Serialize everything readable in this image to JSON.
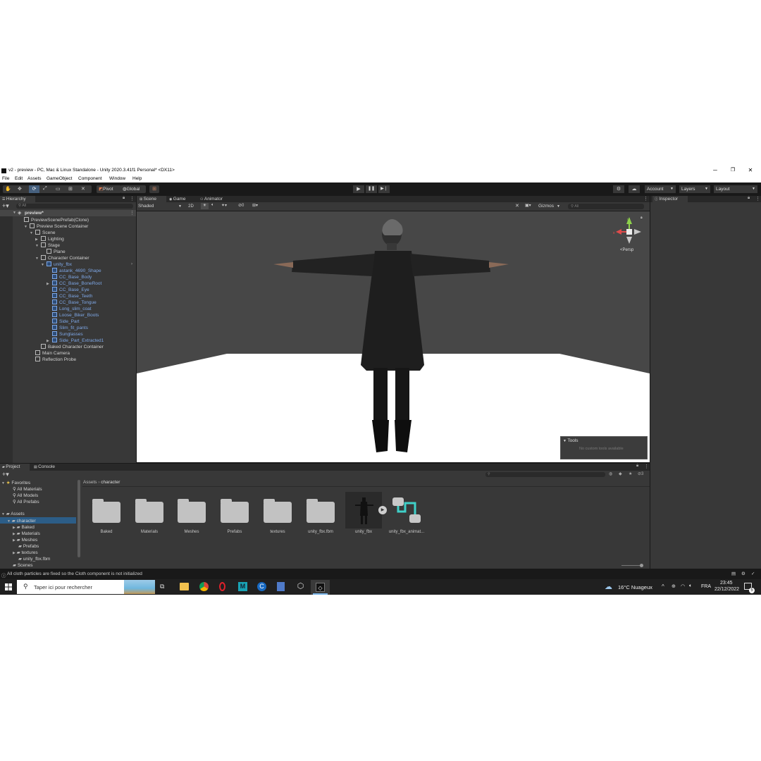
{
  "window": {
    "title": "v2 - preview - PC, Mac & Linux Standalone - Unity 2020.3.41f1 Personal* <DX11>",
    "controls": [
      "─",
      "❐",
      "✕"
    ]
  },
  "menu": [
    "File",
    "Edit",
    "Assets",
    "GameObject",
    "Component",
    "Window",
    "Help"
  ],
  "toolbar": {
    "pivot": "Pivot",
    "global": "Global",
    "account": "Account",
    "layers": "Layers",
    "layout": "Layout"
  },
  "hierarchy": {
    "tab": "Hierarchy",
    "search_placeholder": "All",
    "root": "preview*",
    "items": [
      {
        "label": "PreviewScenePrefab(Clone)",
        "depth": 1,
        "blue": false
      },
      {
        "label": "Preview Scene Container",
        "depth": 2,
        "blue": false
      },
      {
        "label": "Scene",
        "depth": 3,
        "blue": false
      },
      {
        "label": "Lighting",
        "depth": 4,
        "blue": false
      },
      {
        "label": "Stage",
        "depth": 4,
        "blue": false
      },
      {
        "label": "Plane",
        "depth": 5,
        "blue": false
      },
      {
        "label": "Character Container",
        "depth": 4,
        "blue": false
      },
      {
        "label": "unity_fbx",
        "depth": 5,
        "blue": true
      },
      {
        "label": "astank_4690_Shape",
        "depth": 6,
        "blue": true
      },
      {
        "label": "CC_Base_Body",
        "depth": 6,
        "blue": true
      },
      {
        "label": "CC_Base_BoneRoot",
        "depth": 6,
        "blue": true
      },
      {
        "label": "CC_Base_Eye",
        "depth": 6,
        "blue": true
      },
      {
        "label": "CC_Base_Teeth",
        "depth": 6,
        "blue": true
      },
      {
        "label": "CC_Base_Tongue",
        "depth": 6,
        "blue": true
      },
      {
        "label": "Long_slim_coat",
        "depth": 6,
        "blue": true
      },
      {
        "label": "Loose_Biker_Boots",
        "depth": 6,
        "blue": true
      },
      {
        "label": "Side_Part",
        "depth": 6,
        "blue": true
      },
      {
        "label": "Slim_fit_pants",
        "depth": 6,
        "blue": true
      },
      {
        "label": "Sunglasses",
        "depth": 6,
        "blue": true
      },
      {
        "label": "Side_Part_Extracted1",
        "depth": 6,
        "blue": true
      },
      {
        "label": "Baked Character Container",
        "depth": 4,
        "blue": false
      },
      {
        "label": "Main Camera",
        "depth": 3,
        "blue": false
      },
      {
        "label": "Reflection Probe",
        "depth": 3,
        "blue": false
      }
    ]
  },
  "scene": {
    "tabs": [
      "Scene",
      "Game",
      "Animator"
    ],
    "shading": "Shaded",
    "mode2d": "2D",
    "gizmos": "Gizmos",
    "search_placeholder": "All",
    "persp": "<Persp",
    "hidden_count": "0",
    "tools_title": "Tools",
    "tools_msg": "No custom tools available"
  },
  "inspector": {
    "tab": "Inspector"
  },
  "project": {
    "tabs": [
      "Project",
      "Console"
    ],
    "favorites_label": "Favorites",
    "favorites": [
      "All Materials",
      "All Models",
      "All Prefabs"
    ],
    "assets_label": "Assets",
    "tree": [
      "character",
      "Baked",
      "Materials",
      "Meshes",
      "Prefabs",
      "textures",
      "unity_fbx.fbm",
      "Scenes"
    ],
    "breadcrumb": [
      "Assets",
      "character"
    ],
    "hidden_count": "3",
    "items": [
      "Baked",
      "Materials",
      "Meshes",
      "Prefabs",
      "textures",
      "unity_fbx.fbm",
      "unity_fbx",
      "unity_fbx_animat..."
    ]
  },
  "status": {
    "message": "All cloth particles are fixed so the Cloth component is not initialized"
  },
  "taskbar": {
    "search_placeholder": "Taper ici pour rechercher",
    "weather": "16°C  Nuageux",
    "lang": "FRA",
    "time": "23:45",
    "date": "22/12/2022",
    "notif_count": "5"
  },
  "colors": {
    "accent": "#7ea7e6",
    "panel": "#383838",
    "dark": "#191919",
    "scene_bg": "#474747"
  }
}
